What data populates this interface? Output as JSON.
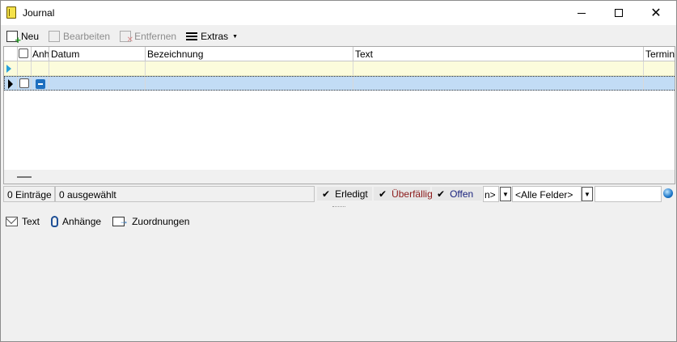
{
  "window": {
    "title": "Journal"
  },
  "toolbar": {
    "new_label": "Neu",
    "edit_label": "Bearbeiten",
    "delete_label": "Entfernen",
    "extras_label": "Extras"
  },
  "grid": {
    "columns": [
      "Anh",
      "Datum",
      "Bezeichnung",
      "Text",
      "Termin/"
    ]
  },
  "status": {
    "entries": "0 Einträge",
    "selected": "0 ausgewählt",
    "filter_done": "Erledigt",
    "filter_overdue": "Überfällig",
    "filter_open": "Offen",
    "combo_partial": "n>",
    "fields_combo": "<Alle Felder>",
    "search_value": ""
  },
  "colors": {
    "overdue": "#8b1a1a",
    "open": "#1a237e",
    "selected_row": "#c2dcf5",
    "new_row": "#fcfcdc"
  },
  "tabs": [
    {
      "label": "Text",
      "icon": "mail-icon"
    },
    {
      "label": "Anhänge",
      "icon": "paperclip-icon"
    },
    {
      "label": "Zuordnungen",
      "icon": "assign-icon"
    }
  ]
}
